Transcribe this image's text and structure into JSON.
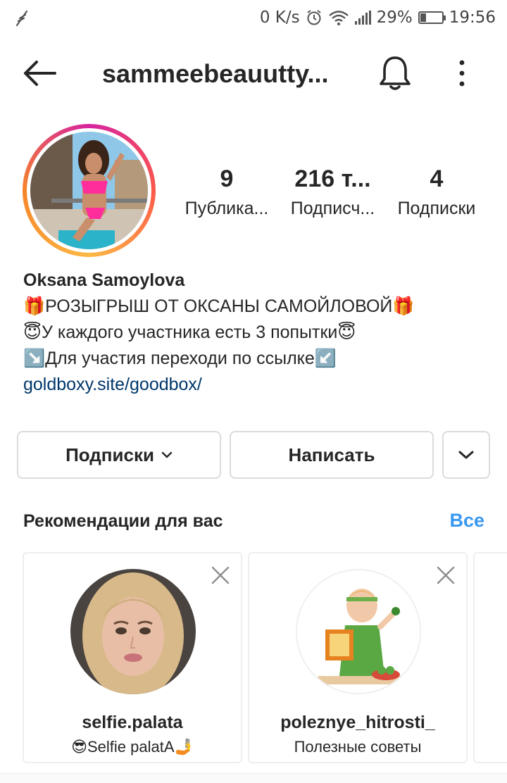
{
  "status_bar": {
    "net_speed": "0 K/s",
    "battery": "29%",
    "battery_level": 0.29,
    "time": "19:56",
    "icons": [
      "alarm-icon",
      "wifi-icon",
      "signal-icon",
      "battery-icon"
    ]
  },
  "header": {
    "username": "sammeebeauutty...",
    "icons": [
      "back-arrow-icon",
      "bell-icon",
      "more-vertical-icon"
    ]
  },
  "stats": [
    {
      "value": "9",
      "label": "Публика..."
    },
    {
      "value": "216 т...",
      "label": "Подписч..."
    },
    {
      "value": "4",
      "label": "Подписки"
    }
  ],
  "bio": {
    "name": "Oksana Samoylova",
    "lines": [
      "🎁РОЗЫГРЫШ ОТ ОКСАНЫ САМОЙЛОВОЙ🎁",
      "😇У каждого участника есть 3 попытки😇",
      "↘️Для участия переходи по ссылке↙️"
    ],
    "link": "goldboxy.site/goodbox/"
  },
  "actions": {
    "following": "Подписки",
    "message": "Написать"
  },
  "suggestions": {
    "title": "Рекомендации для вас",
    "see_all": "Все",
    "cards": [
      {
        "username": "selfie.palata",
        "subtitle": "😎Selfie palatA🤳"
      },
      {
        "username": "poleznye_hitrosti_",
        "subtitle": "Полезные советы"
      }
    ]
  },
  "colors": {
    "link": "#00376b",
    "accent": "#3897f0",
    "text": "#262626",
    "border": "#dbdbdb"
  }
}
